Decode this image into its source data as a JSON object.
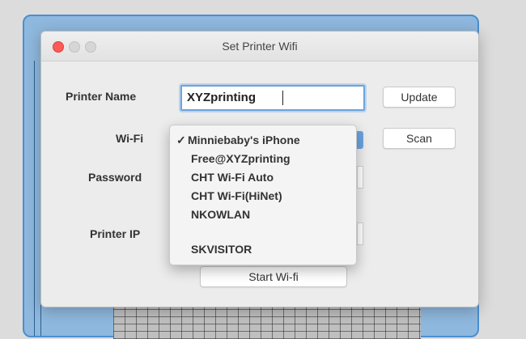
{
  "window": {
    "title": "Set Printer Wifi"
  },
  "form": {
    "printer_name_label": "Printer Name",
    "printer_name_value": "XYZprinting",
    "wifi_label": "Wi-Fi",
    "password_label": "Password",
    "printer_ip_label": "Printer IP"
  },
  "buttons": {
    "update": "Update",
    "scan": "Scan",
    "start_wifi": "Start Wi-fi"
  },
  "wifi_dropdown": {
    "check_mark": "✓",
    "selected": "Minniebaby's iPhone",
    "options": [
      "Minniebaby's iPhone",
      "Free@XYZprinting",
      "CHT Wi-Fi Auto",
      "CHT Wi-Fi(HiNet)",
      "NKOWLAN",
      "SKVISITOR"
    ]
  },
  "colors": {
    "focus": "#6aa4e0",
    "close": "#fc5b57",
    "background_window": "#8fb8de"
  }
}
